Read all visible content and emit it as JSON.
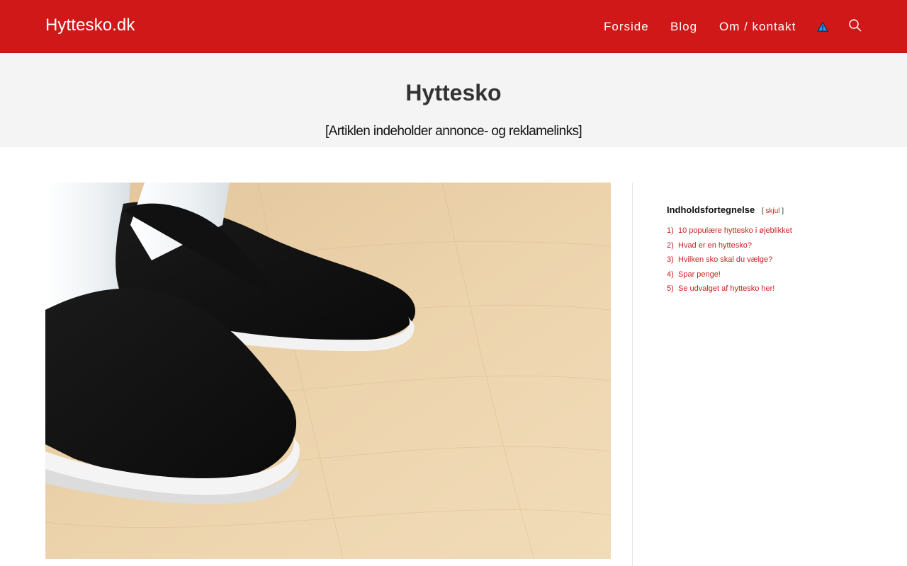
{
  "header": {
    "logo": "Hyttesko.dk",
    "nav": {
      "forside": "Forside",
      "blog": "Blog",
      "om_kontakt": "Om / kontakt"
    },
    "icons": {
      "warning": "warning-triangle-icon",
      "search": "search-icon"
    },
    "colors": {
      "background": "#d01818",
      "text": "#ffffff"
    }
  },
  "page": {
    "title": "Hyttesko",
    "disclaimer": "[Artiklen indeholder annonce- og reklamelinks]"
  },
  "toc": {
    "title": "Indholdsfortegnelse",
    "toggle_open": "[",
    "toggle_label": "skjul",
    "toggle_close": "]",
    "items": [
      {
        "num": "1)",
        "label": "10 populære hyttesko i øjeblikket"
      },
      {
        "num": "2)",
        "label": "Hvad er en hyttesko?"
      },
      {
        "num": "3)",
        "label": "Hvilken sko skal du vælge?"
      },
      {
        "num": "4)",
        "label": "Spar penge!"
      },
      {
        "num": "5)",
        "label": "Se udvalget af hyttesko her!"
      }
    ],
    "link_color": "#c81f1f"
  }
}
